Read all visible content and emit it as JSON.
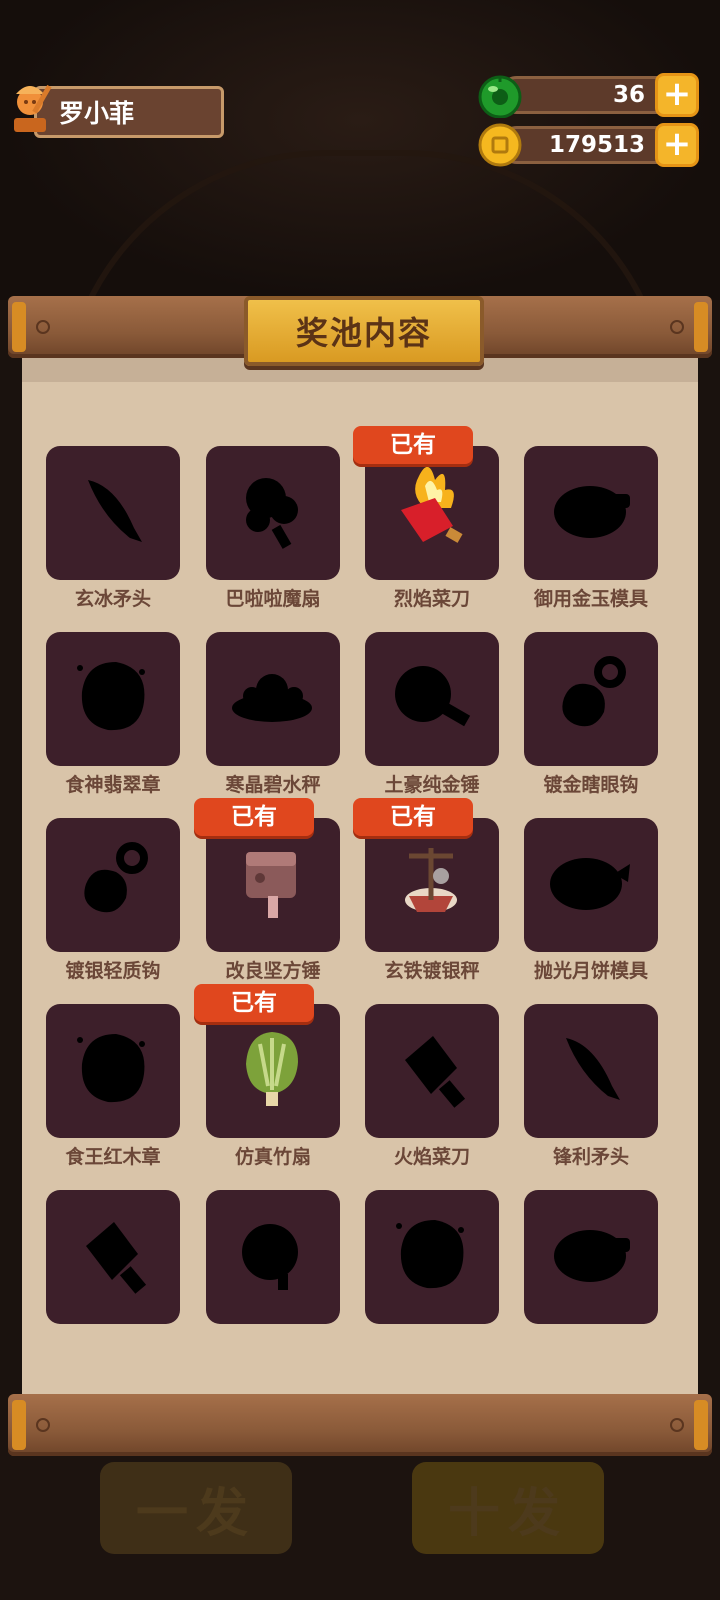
{
  "player": {
    "name": "罗小菲",
    "icon": "chef-trophy-icon"
  },
  "resources": {
    "gems": {
      "value": "36",
      "icon": "jade-gem-icon"
    },
    "coins": {
      "value": "179513",
      "icon": "gold-coin-icon"
    }
  },
  "panel": {
    "title": "奖池内容"
  },
  "owned_label": "已有",
  "background_buttons": {
    "single": "一发",
    "ten": "十发"
  },
  "items": [
    {
      "name": "玄冰矛头",
      "owned": false,
      "icon": "spearhead-silhouette-icon"
    },
    {
      "name": "巴啦啦魔扇",
      "owned": false,
      "icon": "magic-fan-silhouette-icon"
    },
    {
      "name": "烈焰菜刀",
      "owned": true,
      "icon": "flame-cleaver-icon"
    },
    {
      "name": "御用金玉模具",
      "owned": false,
      "icon": "mold-silhouette-icon"
    },
    {
      "name": "食神翡翠章",
      "owned": false,
      "icon": "seal-silhouette-icon"
    },
    {
      "name": "寒晶碧水秤",
      "owned": false,
      "icon": "scale-silhouette-icon"
    },
    {
      "name": "土豪纯金锤",
      "owned": false,
      "icon": "hammer-silhouette-icon"
    },
    {
      "name": "镀金瞎眼钩",
      "owned": false,
      "icon": "hook-silhouette-icon"
    },
    {
      "name": "镀银轻质钩",
      "owned": false,
      "icon": "hook-silhouette-icon"
    },
    {
      "name": "改良坚方锤",
      "owned": true,
      "icon": "square-hammer-icon"
    },
    {
      "name": "玄铁镀银秤",
      "owned": true,
      "icon": "iron-scale-icon"
    },
    {
      "name": "抛光月饼模具",
      "owned": false,
      "icon": "mooncake-mold-silhouette-icon"
    },
    {
      "name": "食王红木章",
      "owned": false,
      "icon": "seal-silhouette-icon"
    },
    {
      "name": "仿真竹扇",
      "owned": true,
      "icon": "bamboo-fan-icon"
    },
    {
      "name": "火焰菜刀",
      "owned": false,
      "icon": "cleaver-silhouette-icon"
    },
    {
      "name": "锋利矛头",
      "owned": false,
      "icon": "spearhead-silhouette-icon"
    },
    {
      "name": "",
      "owned": false,
      "icon": "cleaver-silhouette-icon"
    },
    {
      "name": "",
      "owned": false,
      "icon": "fan-silhouette-icon"
    },
    {
      "name": "",
      "owned": false,
      "icon": "seal-silhouette-icon"
    },
    {
      "name": "",
      "owned": false,
      "icon": "mold-silhouette-icon"
    }
  ]
}
